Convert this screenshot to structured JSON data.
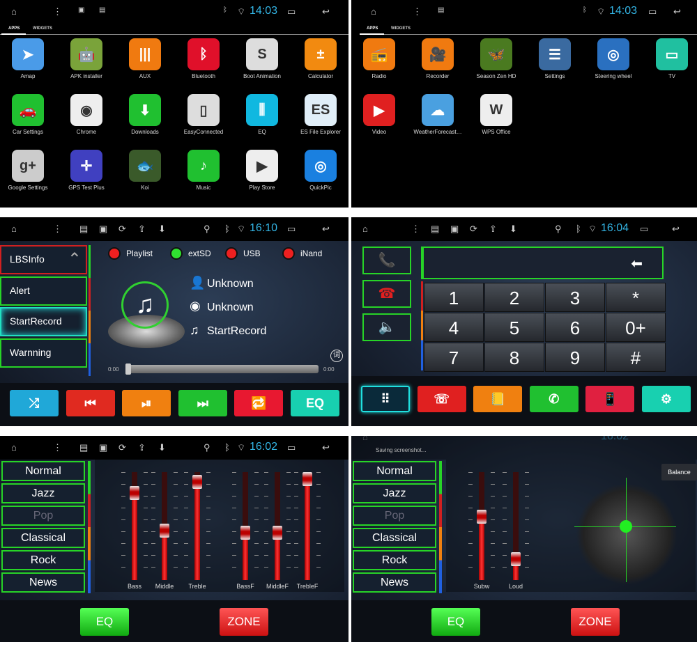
{
  "status": {
    "time_a": "14:03",
    "time_b": "16:10",
    "time_c": "16:04",
    "time_d": "16:02"
  },
  "launcher": {
    "tabs": [
      "APPS",
      "WIDGETS"
    ],
    "page1": [
      {
        "label": "Amap",
        "color": "#4a9be8",
        "glyph": "➤"
      },
      {
        "label": "APK installer",
        "color": "#7aa33a",
        "glyph": "🤖"
      },
      {
        "label": "AUX",
        "color": "#f07a10",
        "glyph": "|||"
      },
      {
        "label": "Bluetooth",
        "color": "#e0102a",
        "glyph": "ᛒ"
      },
      {
        "label": "Boot Animation",
        "color": "#dddddd",
        "glyph": "S"
      },
      {
        "label": "Calculator",
        "color": "#f28a10",
        "glyph": "±"
      },
      {
        "label": "Car Settings",
        "color": "#20c030",
        "glyph": "🚗"
      },
      {
        "label": "Chrome",
        "color": "#eeeeee",
        "glyph": "◉"
      },
      {
        "label": "Downloads",
        "color": "#20c030",
        "glyph": "⬇"
      },
      {
        "label": "EasyConnected",
        "color": "#dddddd",
        "glyph": "▯"
      },
      {
        "label": "EQ",
        "color": "#10b8e0",
        "glyph": "⫼"
      },
      {
        "label": "ES File Explorer",
        "color": "#e0eef8",
        "glyph": "ES"
      },
      {
        "label": "Google Settings",
        "color": "#cccccc",
        "glyph": "g+"
      },
      {
        "label": "GPS Test Plus",
        "color": "#4040c0",
        "glyph": "✛"
      },
      {
        "label": "Koi",
        "color": "#3a5a2a",
        "glyph": "🐟"
      },
      {
        "label": "Music",
        "color": "#20c030",
        "glyph": "♪"
      },
      {
        "label": "Play Store",
        "color": "#eeeeee",
        "glyph": "▶"
      },
      {
        "label": "QuickPic",
        "color": "#1a80e0",
        "glyph": "◎"
      }
    ],
    "page2": [
      {
        "label": "Radio",
        "color": "#f07a10",
        "glyph": "📻"
      },
      {
        "label": "Recorder",
        "color": "#f07a10",
        "glyph": "🎥"
      },
      {
        "label": "Season Zen HD",
        "color": "#4a7a20",
        "glyph": "🦋"
      },
      {
        "label": "Settings",
        "color": "#3a6aa0",
        "glyph": "☰"
      },
      {
        "label": "Steering wheel",
        "color": "#2a70c0",
        "glyph": "◎"
      },
      {
        "label": "TV",
        "color": "#20c0a0",
        "glyph": "▭"
      },
      {
        "label": "Video",
        "color": "#e02020",
        "glyph": "▶"
      },
      {
        "label": "WeatherForecast…",
        "color": "#4aa0e0",
        "glyph": "☁"
      },
      {
        "label": "WPS Office",
        "color": "#eeeeee",
        "glyph": "W"
      }
    ]
  },
  "music": {
    "menu": [
      "LBSInfo",
      "Alert",
      "StartRecord",
      "Warnning"
    ],
    "sources": [
      {
        "label": "Playlist",
        "color": "#ee2020"
      },
      {
        "label": "extSD",
        "color": "#30e030"
      },
      {
        "label": "USB",
        "color": "#ee2020"
      },
      {
        "label": "iNand",
        "color": "#ee2020"
      }
    ],
    "artist": "Unknown",
    "album": "Unknown",
    "title": "StartRecord",
    "time_start": "0:00",
    "time_end": "0:00",
    "progress": 0,
    "lyrics_glyph": "词",
    "controls": [
      {
        "name": "shuffle",
        "glyph": "⤮",
        "color": "#20a8d8"
      },
      {
        "name": "previous",
        "glyph": "⏮",
        "color": "#e02a20"
      },
      {
        "name": "play-pause",
        "glyph": "⏯",
        "color": "#f08010"
      },
      {
        "name": "next",
        "glyph": "⏭",
        "color": "#20c030"
      },
      {
        "name": "repeat",
        "glyph": "🔁",
        "color": "#e81830"
      },
      {
        "name": "eq",
        "glyph": "EQ",
        "color": "#18d0b0"
      }
    ]
  },
  "phone": {
    "backspace": "⬅",
    "keys": [
      "1",
      "2",
      "3",
      "*",
      "4",
      "5",
      "6",
      "0+",
      "7",
      "8",
      "9",
      "#"
    ],
    "side": [
      {
        "name": "call",
        "glyph": "📞",
        "color": "#30d030"
      },
      {
        "name": "hangup",
        "glyph": "☎",
        "color": "#e02020"
      },
      {
        "name": "volume",
        "glyph": "🔈",
        "color": "#ffffff"
      }
    ],
    "bottom": [
      {
        "name": "dialpad",
        "glyph": "⠿",
        "color": "#0a2a3a"
      },
      {
        "name": "call-log",
        "glyph": "☏",
        "color": "#e02020"
      },
      {
        "name": "contacts",
        "glyph": "📒",
        "color": "#f08010"
      },
      {
        "name": "bt-call",
        "glyph": "✆",
        "color": "#20c030"
      },
      {
        "name": "device",
        "glyph": "📱",
        "color": "#e02040"
      },
      {
        "name": "settings",
        "glyph": "⚙",
        "color": "#18d0b0"
      }
    ]
  },
  "eq": {
    "presets": [
      "Normal",
      "Jazz",
      "Pop",
      "Classical",
      "Rock",
      "News"
    ],
    "selected_dim": "Pop",
    "bands": [
      {
        "label": "Bass",
        "level": 0.85
      },
      {
        "label": "Middle",
        "level": 0.45
      },
      {
        "label": "Treble",
        "level": 0.97
      },
      {
        "label": "BassF",
        "level": 0.43
      },
      {
        "label": "MiddleF",
        "level": 0.43
      },
      {
        "label": "TrebleF",
        "level": 1.0
      }
    ],
    "eq_label": "EQ",
    "zone_label": "ZONE"
  },
  "zone": {
    "notification": "Saving screenshot...",
    "balance_label": "Balance",
    "bands": [
      {
        "label": "Subw",
        "level": 0.6
      },
      {
        "label": "Loud",
        "level": 0.15
      }
    ]
  }
}
